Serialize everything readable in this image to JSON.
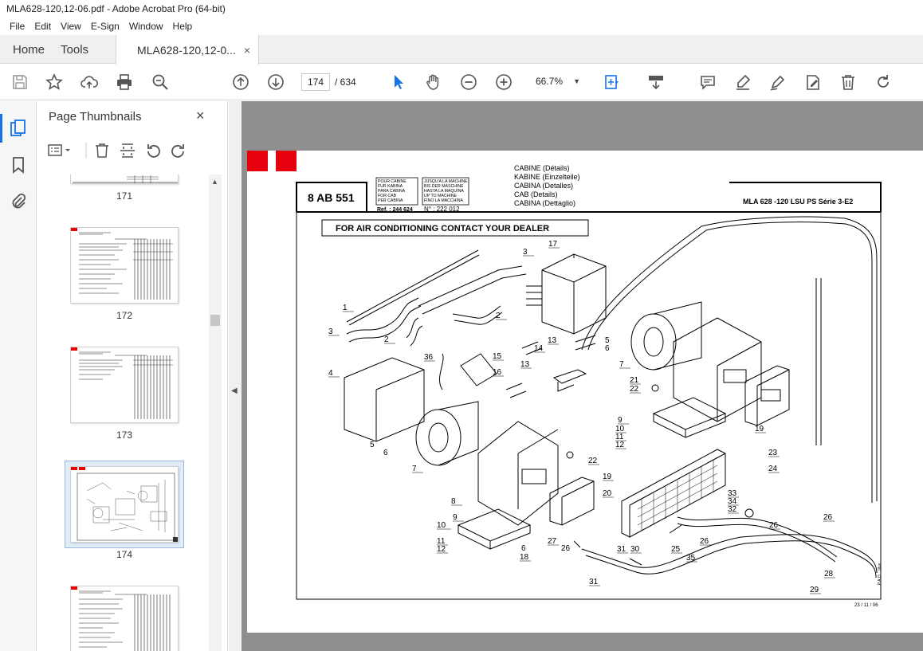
{
  "window": {
    "title": "MLA628-120,12-06.pdf - Adobe Acrobat Pro (64-bit)"
  },
  "menu": [
    "File",
    "Edit",
    "View",
    "E-Sign",
    "Window",
    "Help"
  ],
  "tabs": {
    "home": "Home",
    "tools": "Tools",
    "document": "MLA628-120,12-0...",
    "close": "×"
  },
  "toolbar": {
    "page_current": "174",
    "page_total": "/ 634",
    "zoom": "66.7%"
  },
  "thumbnails": {
    "title": "Page Thumbnails",
    "close": "×",
    "pages": [
      "171",
      "172",
      "173",
      "174"
    ],
    "selected": "174"
  },
  "document": {
    "ref_code": "8 AB 551",
    "for_cab_box": [
      "POUR CABINE",
      "FUR KABINA",
      "PARA CABINA",
      "FOR CAB",
      "PER CABINA"
    ],
    "for_cab_ref": "Ref. : 244 624",
    "machine_box": [
      "JUSQU'A LA MACHINE",
      "BIS DER MASCHINE",
      "HASTA LA MAQUINA",
      "UP TO MACHINE",
      "FINO LA MACCHINA"
    ],
    "machine_ref": "N° : 222 012",
    "titles": [
      "CABINE (Détails)",
      "KABINE (Einzelteile)",
      "CABINA (Detalles)",
      "CAB (Details)",
      "CABINA (Dettaglio)"
    ],
    "model": "MLA 628 -120 LSU PS Série 3-E2",
    "notice": "FOR AIR CONDITIONING CONTACT YOUR DEALER",
    "date": "23 / 11 / 06",
    "side_note": "P.A.O. : Illus",
    "callouts": [
      {
        "n": "1"
      },
      {
        "n": "3"
      },
      {
        "n": "3"
      },
      {
        "n": "2"
      },
      {
        "n": "2"
      },
      {
        "n": "17"
      },
      {
        "n": "36"
      },
      {
        "n": "15"
      },
      {
        "n": "16"
      },
      {
        "n": "13"
      },
      {
        "n": "14"
      },
      {
        "n": "13"
      },
      {
        "n": "5"
      },
      {
        "n": "6"
      },
      {
        "n": "7"
      },
      {
        "n": "21"
      },
      {
        "n": "22"
      },
      {
        "n": "4"
      },
      {
        "n": "5"
      },
      {
        "n": "6"
      },
      {
        "n": "7"
      },
      {
        "n": "9"
      },
      {
        "n": "10"
      },
      {
        "n": "11"
      },
      {
        "n": "12"
      },
      {
        "n": "19"
      },
      {
        "n": "23"
      },
      {
        "n": "24"
      },
      {
        "n": "22"
      },
      {
        "n": "19"
      },
      {
        "n": "20"
      },
      {
        "n": "8"
      },
      {
        "n": "9"
      },
      {
        "n": "10"
      },
      {
        "n": "11"
      },
      {
        "n": "12"
      },
      {
        "n": "6"
      },
      {
        "n": "18"
      },
      {
        "n": "27"
      },
      {
        "n": "26"
      },
      {
        "n": "31"
      },
      {
        "n": "30"
      },
      {
        "n": "25"
      },
      {
        "n": "26"
      },
      {
        "n": "35"
      },
      {
        "n": "33"
      },
      {
        "n": "34"
      },
      {
        "n": "32"
      },
      {
        "n": "26"
      },
      {
        "n": "26"
      },
      {
        "n": "28"
      },
      {
        "n": "29"
      },
      {
        "n": "31"
      }
    ]
  }
}
